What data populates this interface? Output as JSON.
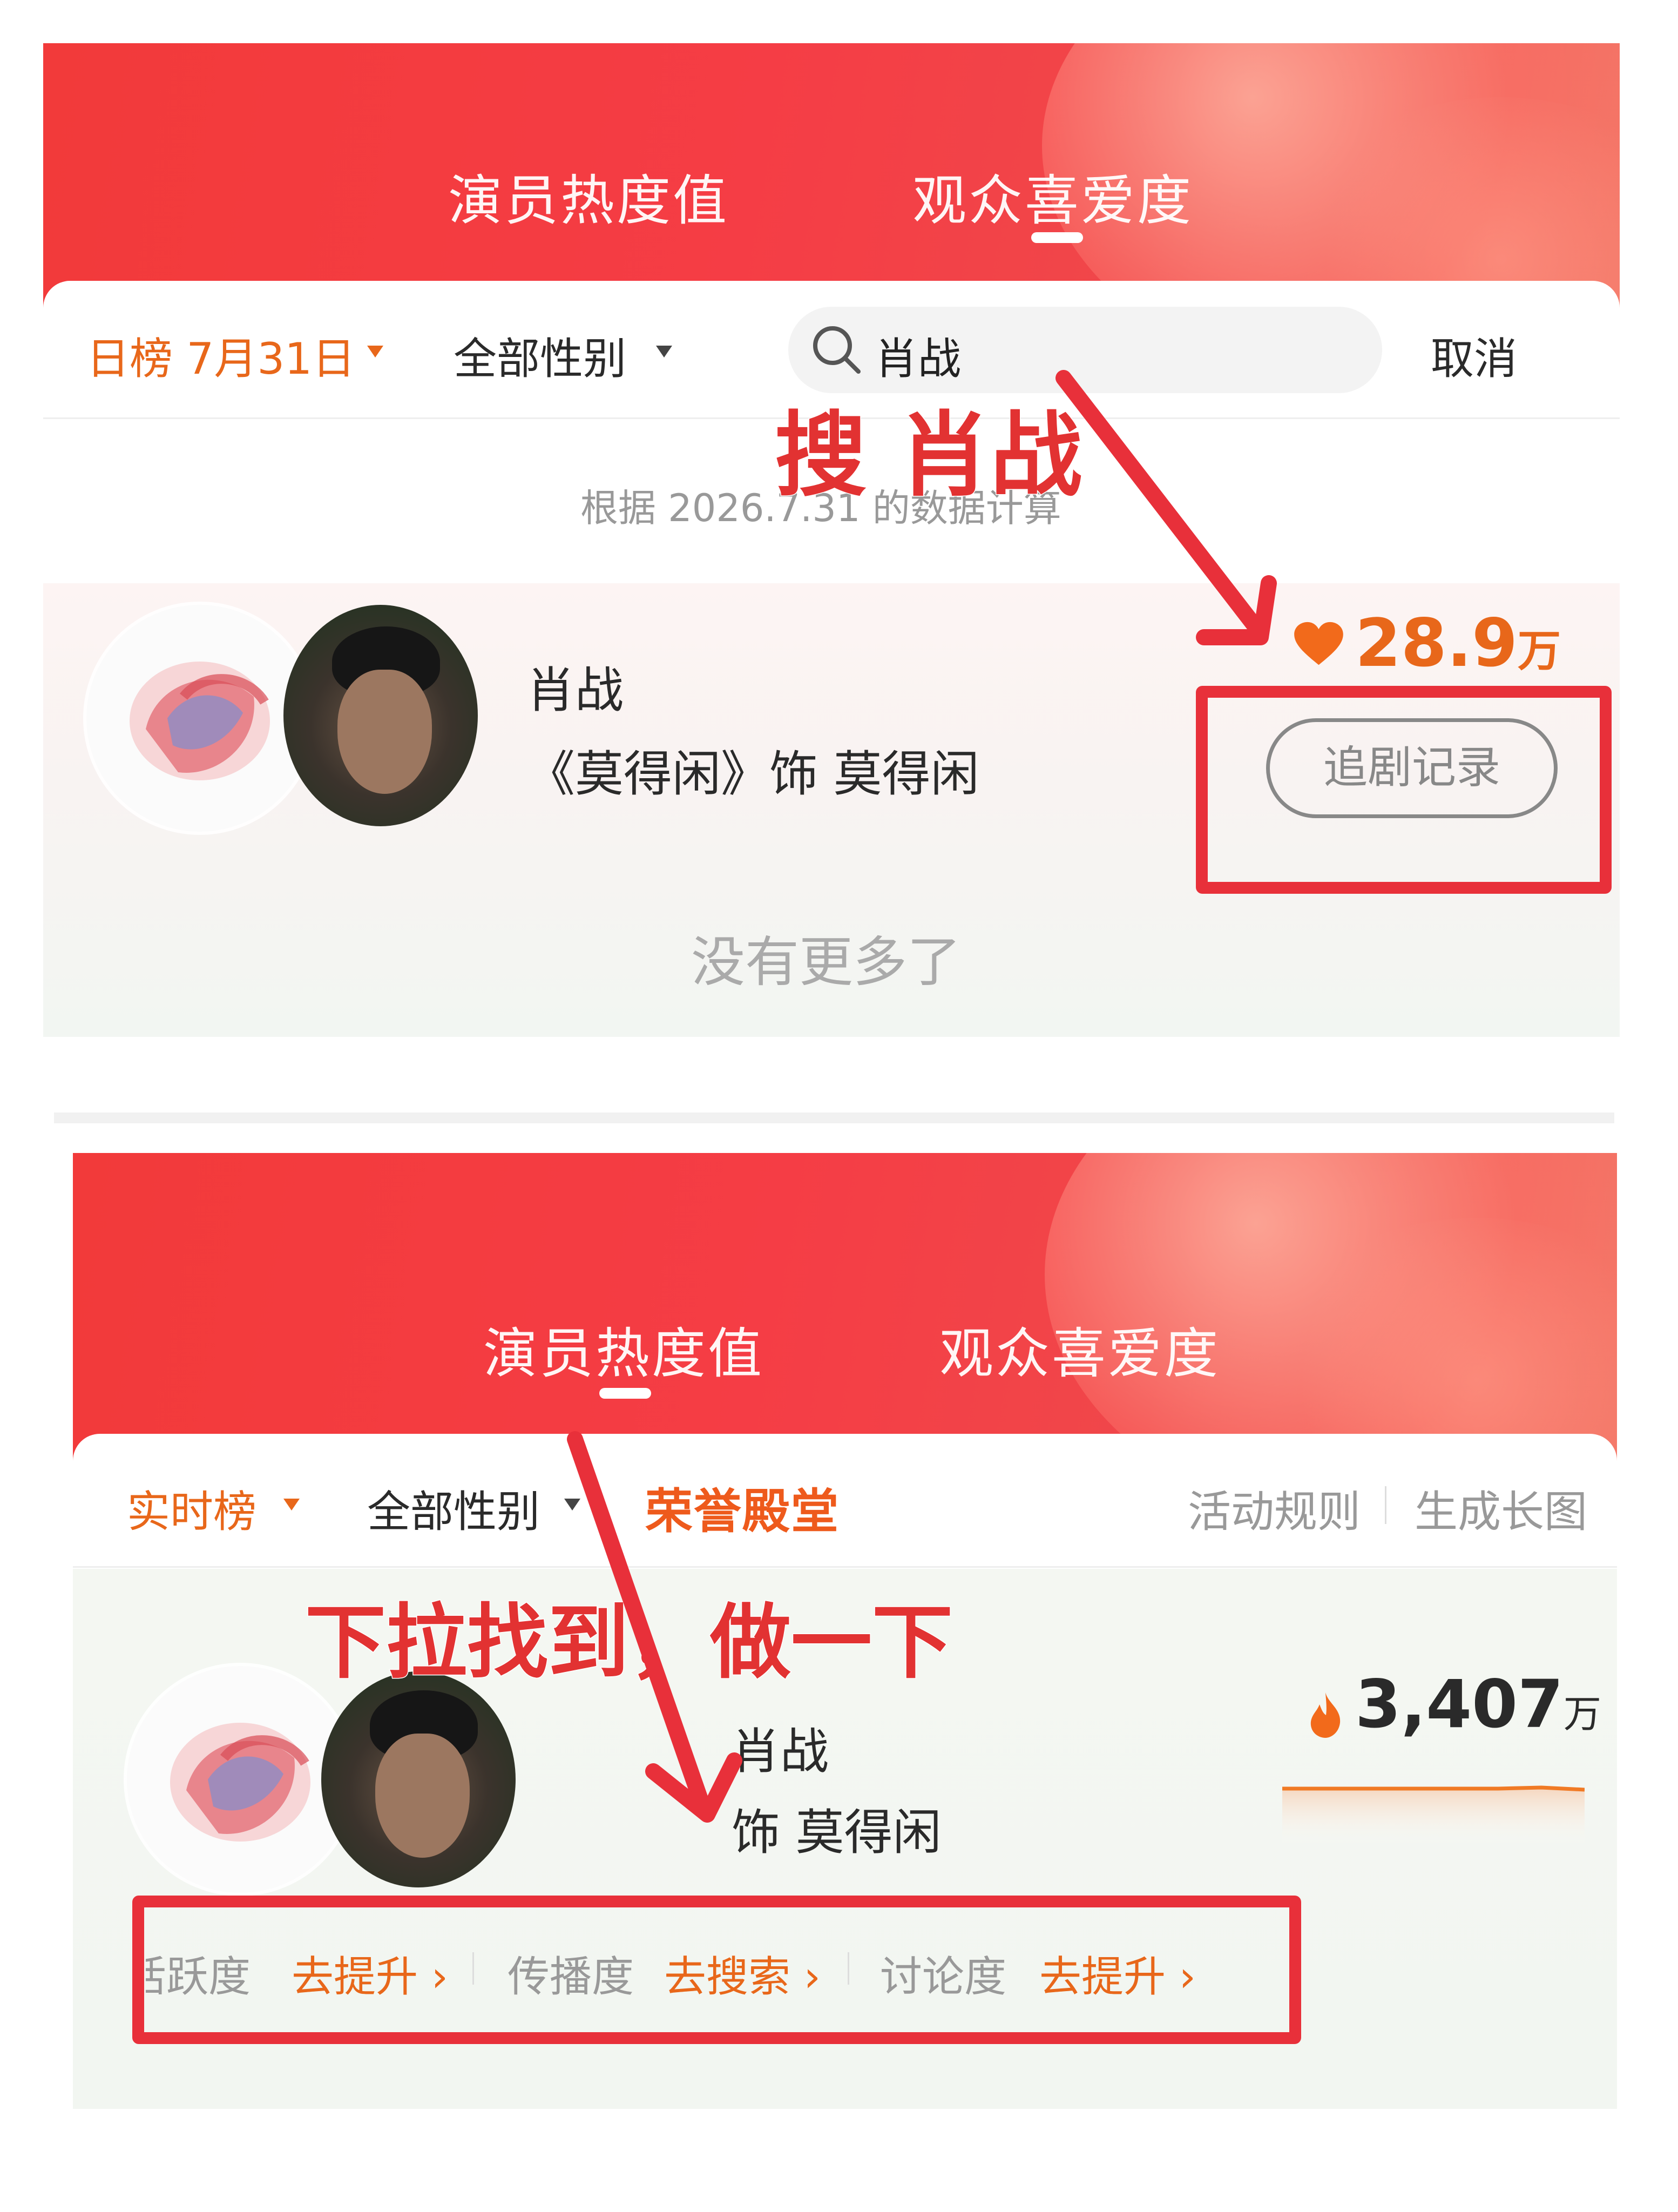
{
  "top": {
    "tabs": [
      {
        "label": "演员热度值",
        "active": false
      },
      {
        "label": "观众喜爱度",
        "active": true
      }
    ],
    "filters": {
      "date": "日榜 7月31日",
      "gender": "全部性别"
    },
    "search": {
      "value": "肖战",
      "cancel": "取消"
    },
    "annotation": "搜 肖战",
    "calc_note": "根据 2026.7.31 的数据计算",
    "card": {
      "name": "肖战",
      "role": "《莫得闲》饰 莫得闲",
      "score_value": "28.9",
      "score_unit": "万",
      "button": "追剧记录"
    },
    "no_more": "没有更多了"
  },
  "bottom": {
    "tabs": [
      {
        "label": "演员热度值",
        "active": true
      },
      {
        "label": "观众喜爱度",
        "active": false
      }
    ],
    "filters": {
      "board": "实时榜",
      "gender": "全部性别",
      "hall": "荣誉殿堂",
      "rules": "活动规则",
      "long_image": "生成长图"
    },
    "annotation": "下拉找到，做一下",
    "card": {
      "name": "肖战",
      "role": "饰 莫得闲",
      "heat_value": "3,407",
      "heat_unit": "万"
    },
    "actions": [
      {
        "label": "活跃度",
        "action": "去提升"
      },
      {
        "label": "传播度",
        "action": "去搜索"
      },
      {
        "label": "讨论度",
        "action": "去提升"
      }
    ]
  },
  "colors": {
    "banner": "#f23a3a",
    "accent_orange": "#e8671a",
    "annotation_red": "#e23232"
  },
  "icons": [
    "search-icon",
    "heart-icon",
    "flame-icon",
    "chevron-right-icon",
    "caret-down-icon",
    "annotation-arrow"
  ]
}
